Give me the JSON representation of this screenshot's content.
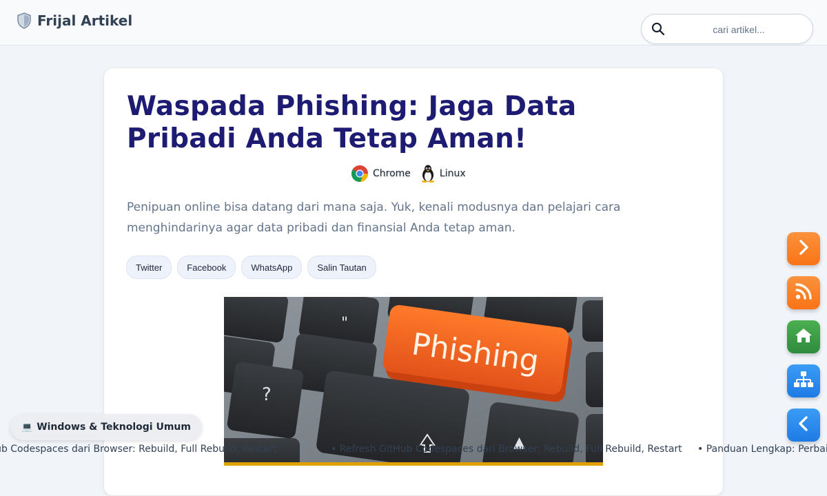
{
  "header": {
    "brand": "Frijal Artikel",
    "brand_icon": "shield-icon",
    "search": {
      "placeholder": "cari artikel..."
    }
  },
  "article": {
    "title": "Waspada Phishing: Jaga Data Pribadi Anda Tetap Aman!",
    "platforms": [
      {
        "label": "Chrome",
        "icon": "chrome-icon"
      },
      {
        "label": "Linux",
        "icon": "linux-tux-icon"
      }
    ],
    "lead": "Penipuan online bisa datang dari mana saja. Yuk, kenali modusnya dan pelajari cara menghindarinya agar data pribadi dan finansial Anda tetap aman.",
    "share": [
      "Twitter",
      "Facebook",
      "WhatsApp",
      "Salin Tautan"
    ],
    "hero_key_label": "Phishing"
  },
  "floating_nav": [
    {
      "icon": "chevron-right-icon",
      "color": "#f97316"
    },
    {
      "icon": "rss-icon",
      "color": "#f97316"
    },
    {
      "icon": "home-icon",
      "color": "#2e8b3e"
    },
    {
      "icon": "sitemap-icon",
      "color": "#1e7be6"
    },
    {
      "icon": "chevron-left-icon",
      "color": "#1e7be6"
    }
  ],
  "category": {
    "icon": "laptop-icon",
    "emoji": "💻",
    "label": "Windows & Teknologi Umum"
  },
  "ticker": {
    "bullet": "•",
    "items": [
      "Refresh GitHub Codespaces dari Browser: Rebuild, Full Rebuild, Restart",
      "Refresh GitHub Codespaces dari Browser: Rebuild, Full Rebuild, Restart",
      "Panduan Lengkap: Perbaiki"
    ]
  }
}
